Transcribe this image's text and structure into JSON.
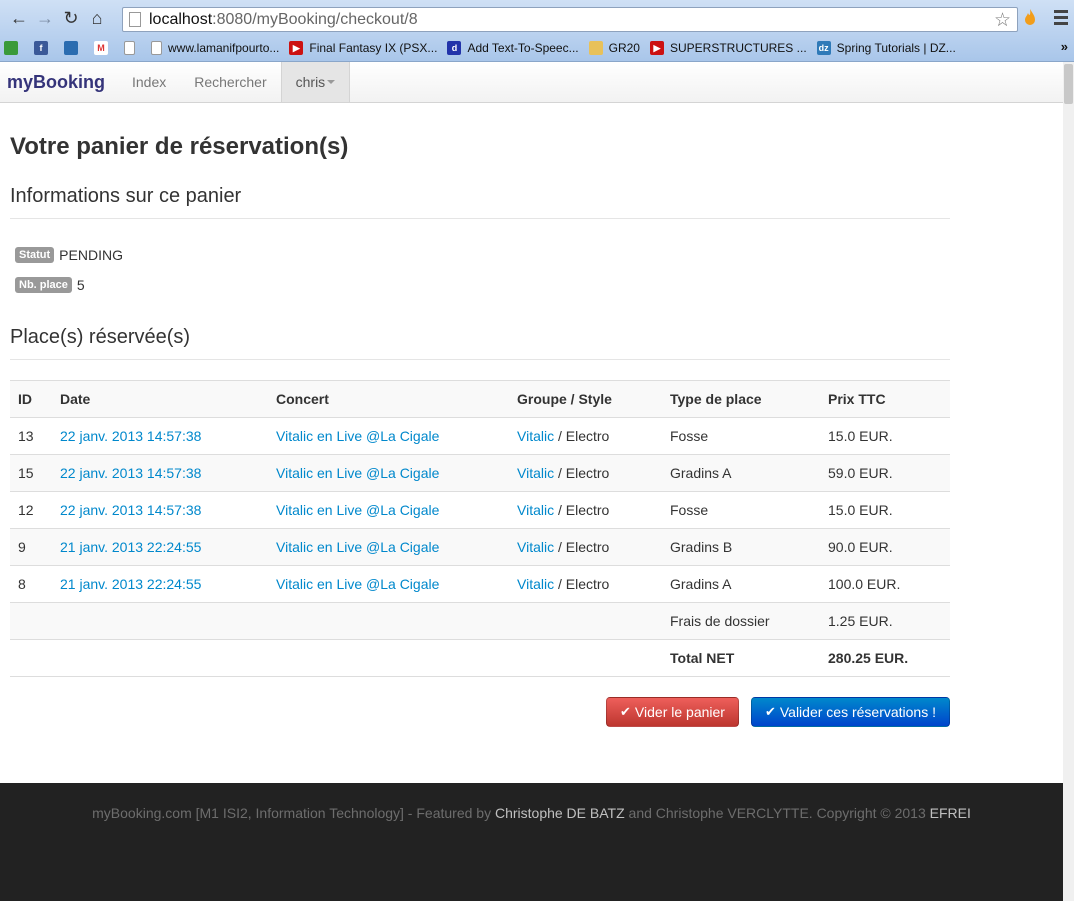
{
  "browser": {
    "url_host": "localhost",
    "url_path": ":8080/myBooking/checkout/8",
    "bookmarks": [
      {
        "label": "",
        "icon": "app-icon",
        "color": "#3a9a3a"
      },
      {
        "label": "",
        "icon": "facebook-icon",
        "color": "#3b5998"
      },
      {
        "label": "",
        "icon": "globe-icon",
        "color": "#2b6cb0"
      },
      {
        "label": "",
        "icon": "gmail-icon",
        "color": "#d33"
      },
      {
        "label": "",
        "icon": "page-icon",
        "color": "#ffffff"
      },
      {
        "label": "www.lamanifpourto...",
        "icon": "page-icon",
        "color": "#ffffff"
      },
      {
        "label": "Final Fantasy IX (PSX...",
        "icon": "youtube-icon",
        "color": "#cc1111"
      },
      {
        "label": "Add Text-To-Speec...",
        "icon": "speech-icon",
        "color": "#2233aa"
      },
      {
        "label": "GR20",
        "icon": "folder-icon",
        "color": "#e8c15a"
      },
      {
        "label": "SUPERSTRUCTURES ...",
        "icon": "youtube-icon",
        "color": "#cc1111"
      },
      {
        "label": "Spring Tutorials | DZ...",
        "icon": "dzone-icon",
        "color": "#2f7ab8"
      }
    ],
    "bookmarks_more": "»"
  },
  "navbar": {
    "brand": "myBooking",
    "links": [
      "Index",
      "Rechercher"
    ],
    "user": "chris"
  },
  "page": {
    "title": "Votre panier de réservation(s)",
    "info_title": "Informations sur ce panier",
    "status_label": "Statut",
    "status_value": "PENDING",
    "places_label": "Nb. place",
    "places_value": "5",
    "places_title": "Place(s) réservée(s)"
  },
  "table": {
    "headers": [
      "ID",
      "Date",
      "Concert",
      "Groupe / Style",
      "Type de place",
      "Prix TTC"
    ],
    "rows": [
      {
        "id": "13",
        "date": "22 janv. 2013 14:57:38",
        "concert": "Vitalic en Live @La Cigale",
        "group": "Vitalic",
        "style": " / Electro",
        "type": "Fosse",
        "price": "15.0 EUR."
      },
      {
        "id": "15",
        "date": "22 janv. 2013 14:57:38",
        "concert": "Vitalic en Live @La Cigale",
        "group": "Vitalic",
        "style": " / Electro",
        "type": "Gradins A",
        "price": "59.0 EUR."
      },
      {
        "id": "12",
        "date": "22 janv. 2013 14:57:38",
        "concert": "Vitalic en Live @La Cigale",
        "group": "Vitalic",
        "style": " / Electro",
        "type": "Fosse",
        "price": "15.0 EUR."
      },
      {
        "id": "9",
        "date": "21 janv. 2013 22:24:55",
        "concert": "Vitalic en Live @La Cigale",
        "group": "Vitalic",
        "style": " / Electro",
        "type": "Gradins B",
        "price": "90.0 EUR."
      },
      {
        "id": "8",
        "date": "21 janv. 2013 22:24:55",
        "concert": "Vitalic en Live @La Cigale",
        "group": "Vitalic",
        "style": " / Electro",
        "type": "Gradins A",
        "price": "100.0 EUR."
      }
    ],
    "fees_label": "Frais de dossier",
    "fees_value": "1.25 EUR.",
    "total_label": "Total NET",
    "total_value": "280.25 EUR."
  },
  "actions": {
    "empty_cart": "Vider le panier",
    "validate": "Valider ces réservations !"
  },
  "footer": {
    "part1": "myBooking.com [M1 ISI2, Information Technology] - Featured by ",
    "author1": "Christophe DE BATZ",
    "part2": " and Christophe VERCLYTTE. Copyright © 2013 ",
    "org": "EFREI"
  }
}
